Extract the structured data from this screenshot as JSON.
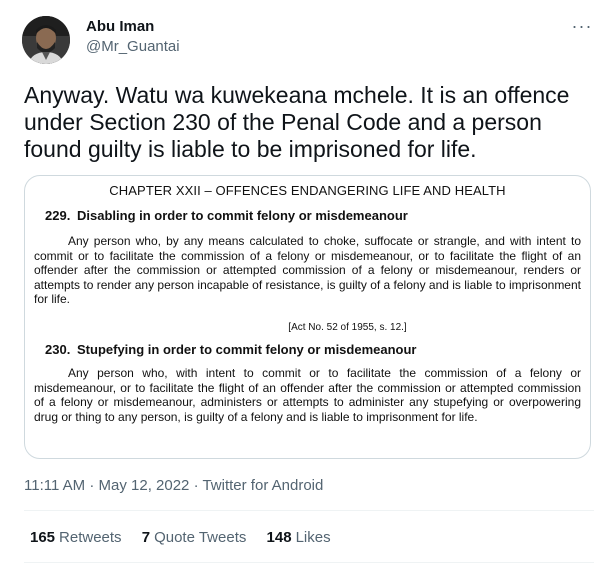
{
  "author": {
    "display_name": "Abu Iman",
    "handle": "@Mr_Guantai"
  },
  "more_icon": "more-horizontal-icon",
  "tweet": {
    "text": "Anyway. Watu wa kuwekeana mchele. It is an offence under Section 230 of the Penal Code and a person found guilty is liable to be imprisoned for life."
  },
  "document": {
    "chapter": "CHAPTER XXII – OFFENCES ENDANGERING LIFE AND HEALTH",
    "sections": [
      {
        "number": "229.",
        "title": "Disabling in order to commit felony or misdemeanour",
        "body": "Any person who, by any means calculated to choke, suffocate or strangle, and with intent to commit or to facilitate the commission of a felony or misdemeanour, or to facilitate the flight of an offender after the commission or attempted commission of a felony or misdemeanour, renders or attempts to render any person incapable of resistance, is guilty of a felony and is liable to imprisonment for life.",
        "citation": "[Act No. 52 of 1955, s. 12.]"
      },
      {
        "number": "230.",
        "title": "Stupefying in order to commit felony or misdemeanour",
        "body": "Any person who, with intent to commit or to facilitate the commission of a felony or misdemeanour, or to facilitate the flight of an offender after the commission or attempted commission of a felony or misdemeanour, administers or attempts to administer any stupefying or overpowering drug or thing to any person, is guilty of a felony and is liable to imprisonment for life."
      }
    ]
  },
  "meta": {
    "time": "11:11 AM",
    "sep1": " · ",
    "date": "May 12, 2022",
    "sep2": " · ",
    "source": "Twitter for Android"
  },
  "stats": {
    "retweets_count": "165",
    "retweets_label": "Retweets",
    "quotes_count": "7",
    "quotes_label": "Quote Tweets",
    "likes_count": "148",
    "likes_label": "Likes"
  }
}
